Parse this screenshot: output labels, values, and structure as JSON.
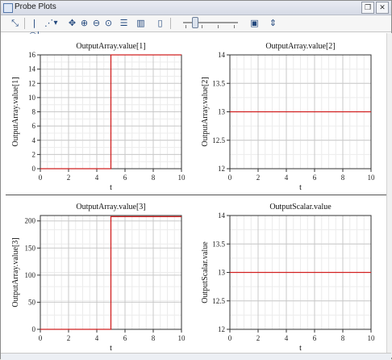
{
  "window": {
    "title": "Probe Plots"
  },
  "toolbar": {
    "icons": [
      "autoscale-icon",
      "function-icon",
      "point-style-icon",
      "pan-icon",
      "zoom-in-icon",
      "zoom-out-icon",
      "zoom-box-icon",
      "legend-icon",
      "data-grid-icon",
      "single-plot-icon",
      "animation-slider",
      "fit-icon",
      "expand-icon"
    ]
  },
  "chart_data": [
    {
      "type": "line",
      "title": "OutputArray.value[1]",
      "xlabel": "t",
      "ylabel": "OutputArray.value[1]",
      "xlim": [
        0,
        10
      ],
      "ylim": [
        0,
        16
      ],
      "xticks": [
        "0",
        "2",
        "4",
        "6",
        "8",
        "10"
      ],
      "yticks": [
        "0",
        "2",
        "4",
        "6",
        "8",
        "10",
        "12",
        "14",
        "16"
      ],
      "series": [
        {
          "x": [
            0,
            5,
            5,
            10
          ],
          "y": [
            0,
            0,
            16,
            16
          ],
          "color": "#d12020"
        }
      ],
      "grid": true
    },
    {
      "type": "line",
      "title": "OutputArray.value[2]",
      "xlabel": "t",
      "ylabel": "OutputArray.value[2]",
      "xlim": [
        0,
        10
      ],
      "ylim": [
        12,
        14
      ],
      "xticks": [
        "0",
        "2",
        "4",
        "6",
        "8",
        "10"
      ],
      "yticks": [
        "12",
        "12.5",
        "13",
        "13.5",
        "14"
      ],
      "series": [
        {
          "x": [
            0,
            10
          ],
          "y": [
            13,
            13
          ],
          "color": "#d12020"
        }
      ],
      "grid": true
    },
    {
      "type": "line",
      "title": "OutputArray.value[3]",
      "xlabel": "t",
      "ylabel": "OutputArray.value[3]",
      "xlim": [
        0,
        10
      ],
      "ylim": [
        0,
        210
      ],
      "xticks": [
        "0",
        "2",
        "4",
        "6",
        "8",
        "10"
      ],
      "yticks": [
        "0",
        "50",
        "100",
        "150",
        "200"
      ],
      "series": [
        {
          "x": [
            0,
            5,
            5,
            10
          ],
          "y": [
            0,
            0,
            208,
            208
          ],
          "color": "#d12020"
        }
      ],
      "grid": true
    },
    {
      "type": "line",
      "title": "OutputScalar.value",
      "xlabel": "t",
      "ylabel": "OutputScalar.value",
      "xlim": [
        0,
        10
      ],
      "ylim": [
        12,
        14
      ],
      "xticks": [
        "0",
        "2",
        "4",
        "6",
        "8",
        "10"
      ],
      "yticks": [
        "12",
        "12.5",
        "13",
        "13.5",
        "14"
      ],
      "series": [
        {
          "x": [
            0,
            10
          ],
          "y": [
            13,
            13
          ],
          "color": "#d12020"
        }
      ],
      "grid": true
    }
  ]
}
